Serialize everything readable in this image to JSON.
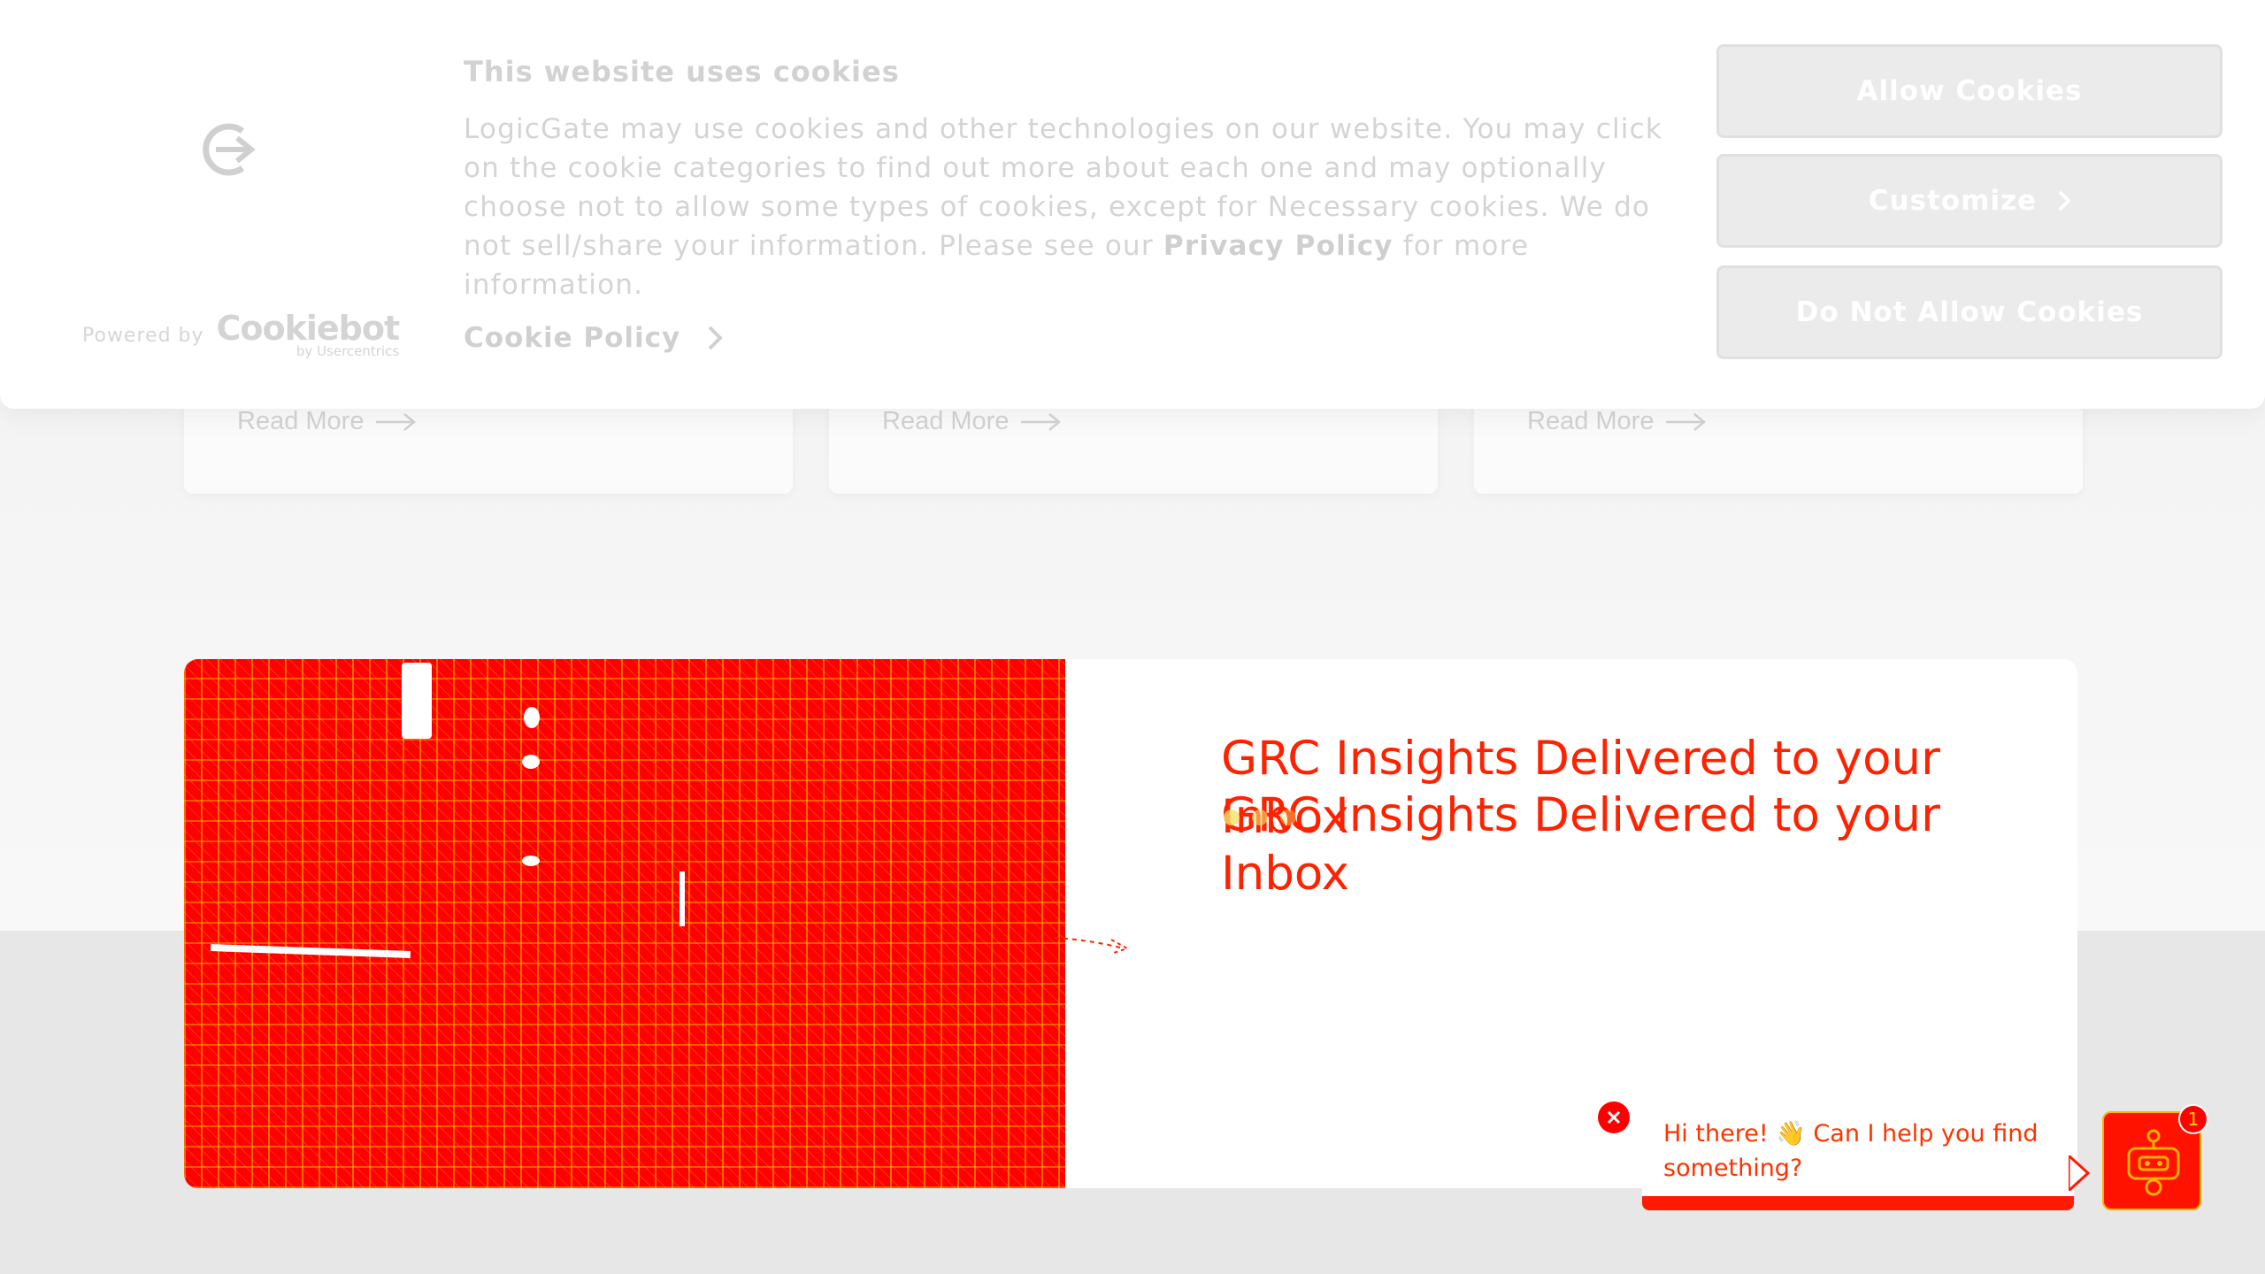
{
  "cookie_banner": {
    "title": "This website uses cookies",
    "body_start": "LogicGate may use cookies and other technologies on our website. You may click on the cookie categories to find out more about each one and may optionally choose not to allow some types of cookies, except for Necessary cookies.  We do not sell/share your information. Please see our ",
    "privacy_link": "Privacy Policy",
    "body_end": " for more information.",
    "cookie_policy_label": "Cookie Policy",
    "powered_by": "Powered by",
    "cookiebot_brand": "Cookiebot",
    "cookiebot_sub": "by Usercentrics",
    "buttons": {
      "allow": "Allow Cookies",
      "customize": "Customize",
      "deny": "Do Not Allow Cookies"
    }
  },
  "resource_cards": [
    {
      "link": "Read More"
    },
    {
      "link": "Read More"
    },
    {
      "link": "Read More"
    }
  ],
  "newsletter": {
    "title": "GRC Insights Delivered to your Inbox"
  },
  "chat": {
    "greeting": "Hi there! 👋 Can I help you find something?",
    "badge_count": "1"
  },
  "colors": {
    "accent": "#ff1a00",
    "banner_text": "#d4d4d4",
    "button_bg": "#ebebeb",
    "footer_bg": "#e7e7e7"
  },
  "icons": [
    "logicgate-logo-icon",
    "cookiebot-logo",
    "chevron-right-icon",
    "arrow-right-icon",
    "close-icon",
    "chatbot-icon"
  ]
}
